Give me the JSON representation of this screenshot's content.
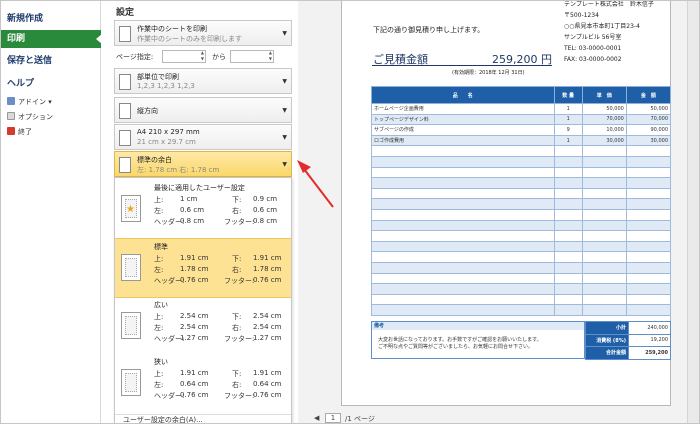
{
  "nav": {
    "new": "新規作成",
    "print": "印刷",
    "save_send": "保存と送信",
    "help": "ヘルプ",
    "addin": "アドイン ▾",
    "options": "オプション",
    "exit": "終了"
  },
  "settings": {
    "title": "設定",
    "print_what": {
      "line1": "作業中のシートを印刷",
      "line2": "作業中のシートのみを印刷します"
    },
    "pages_label": "ページ指定:",
    "pages_to": "から",
    "collate": {
      "line1": "部単位で印刷",
      "line2": "1,2,3    1,2,3    1,2,3"
    },
    "orientation": {
      "line1": "縦方向"
    },
    "paper": {
      "line1": "A4 210 x 297 mm",
      "line2": "21 cm x 29.7 cm"
    },
    "margins": {
      "line1": "標準の余白",
      "line2": "左:  1.78 cm    右:  1.78 cm"
    }
  },
  "margin_menu": {
    "options": [
      {
        "title": "最後に適用したユーザー設定",
        "top": "上:",
        "top_v": "1 cm",
        "bottom": "下:",
        "bottom_v": "0.9 cm",
        "left": "左:",
        "left_v": "0.6 cm",
        "right": "右:",
        "right_v": "0.6 cm",
        "header": "ヘッダー:",
        "header_v": "0.8 cm",
        "footer": "フッター:",
        "footer_v": "0.8 cm"
      },
      {
        "title": "標準",
        "top": "上:",
        "top_v": "1.91 cm",
        "bottom": "下:",
        "bottom_v": "1.91 cm",
        "left": "左:",
        "left_v": "1.78 cm",
        "right": "右:",
        "right_v": "1.78 cm",
        "header": "ヘッダー:",
        "header_v": "0.76 cm",
        "footer": "フッター:",
        "footer_v": "0.76 cm"
      },
      {
        "title": "広い",
        "top": "上:",
        "top_v": "2.54 cm",
        "bottom": "下:",
        "bottom_v": "2.54 cm",
        "left": "左:",
        "left_v": "2.54 cm",
        "right": "右:",
        "right_v": "2.54 cm",
        "header": "ヘッダー:",
        "header_v": "1.27 cm",
        "footer": "フッター:",
        "footer_v": "1.27 cm"
      },
      {
        "title": "狭い",
        "top": "上:",
        "top_v": "1.91 cm",
        "bottom": "下:",
        "bottom_v": "1.91 cm",
        "left": "左:",
        "left_v": "0.64 cm",
        "right": "右:",
        "right_v": "0.64 cm",
        "header": "ヘッダー:",
        "header_v": "0.76 cm",
        "footer": "フッター:",
        "footer_v": "0.76 cm"
      }
    ],
    "custom": "ユーザー設定の余白(A)..."
  },
  "document": {
    "company": "テンプレート株式会社　鈴木信子",
    "zip": "〒500-1234",
    "address": "○○県見本市本町1丁目23-4",
    "building": "サンプルビル 56号室",
    "tel": "TEL: 03-0000-0001",
    "fax": "FAX: 03-0000-0002",
    "intro": "下記の通り御見積り申し上げます。",
    "estimate_label": "ご見積金額",
    "estimate_amount": "259,200 円",
    "validity": "(有効期限：2018年 12月 31日)",
    "columns": [
      "品　　名",
      "数 量",
      "単　価",
      "金　額"
    ],
    "rows": [
      {
        "name": "ホームページ企画費用",
        "qty": "1",
        "price": "50,000",
        "amount": "50,000"
      },
      {
        "name": "トップページデザイン料",
        "qty": "1",
        "price": "70,000",
        "amount": "70,000"
      },
      {
        "name": "サブページの作成",
        "qty": "9",
        "price": "10,000",
        "amount": "90,000"
      },
      {
        "name": "ロゴ作成費用",
        "qty": "1",
        "price": "30,000",
        "amount": "30,000"
      }
    ],
    "notes_title": "備考",
    "notes_line1": "大変お世話になっております。お手数ですがご確認をお願いいたします。",
    "notes_line2": "ご不明な点やご質問等がございましたら、お気軽にお問合せ下さい。",
    "subtotal_label": "小計",
    "subtotal": "240,000",
    "tax_label": "消費税 (8%)",
    "tax": "19,200",
    "total_label": "合計金額",
    "total": "259,200"
  },
  "pager": {
    "page": "1",
    "of": "/1 ページ"
  }
}
